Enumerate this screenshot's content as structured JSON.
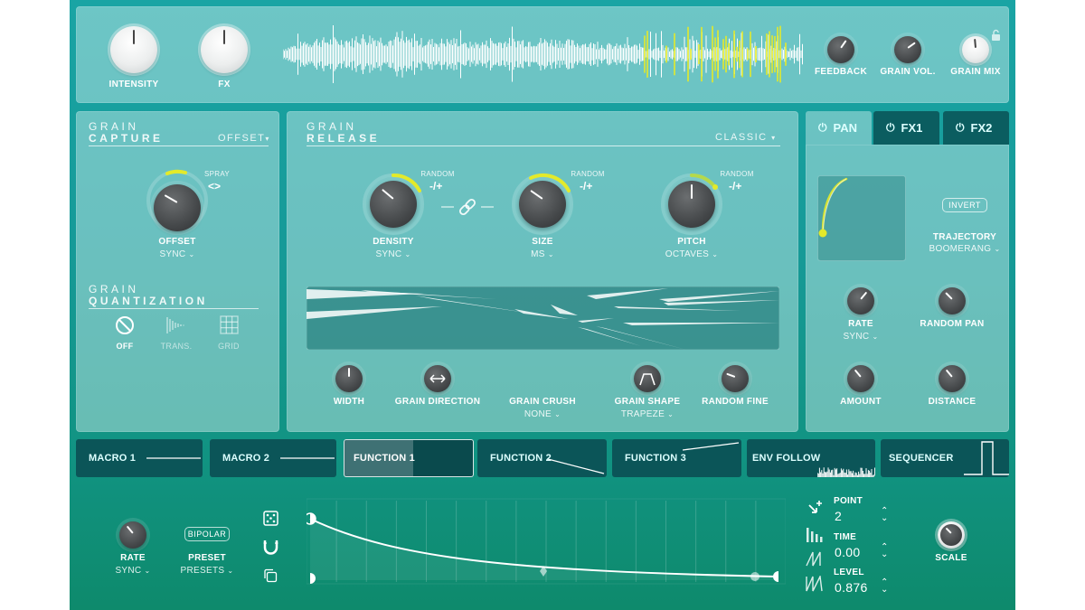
{
  "top": {
    "intensity_label": "INTENSITY",
    "fx_label": "FX",
    "feedback_label": "FEEDBACK",
    "grain_vol_label": "GRAIN VOL.",
    "grain_mix_label": "GRAIN MIX"
  },
  "grain_capture": {
    "title_line1": "GRAIN",
    "title_line2": "CAPTURE",
    "mode": "OFFSET",
    "spray_label": "SPRAY",
    "spray_arrows": "<>",
    "offset_label": "OFFSET",
    "offset_mode": "SYNC"
  },
  "grain_quantization": {
    "title_line1": "GRAIN",
    "title_line2": "QUANTIZATION",
    "options": [
      "OFF",
      "TRANS.",
      "GRID"
    ]
  },
  "grain_release": {
    "title_line1": "GRAIN",
    "title_line2": "RELEASE",
    "mode": "CLASSIC",
    "random_label": "RANDOM",
    "random_sign": "-/+",
    "density_label": "DENSITY",
    "density_mode": "SYNC",
    "size_label": "SIZE",
    "size_mode": "MS",
    "pitch_label": "PITCH",
    "pitch_mode": "OCTAVES",
    "width_label": "WIDTH",
    "grain_direction_label": "GRAIN DIRECTION",
    "grain_crush_label": "GRAIN CRUSH",
    "grain_crush_value": "NONE",
    "grain_shape_label": "GRAIN SHAPE",
    "grain_shape_value": "TRAPEZE",
    "random_fine_label": "RANDOM FINE"
  },
  "fx_tabs": [
    "PAN",
    "FX1",
    "FX2"
  ],
  "pan": {
    "invert_label": "INVERT",
    "trajectory_label": "TRAJECTORY",
    "trajectory_value": "BOOMERANG",
    "rate_label": "RATE",
    "rate_mode": "SYNC",
    "random_pan_label": "RANDOM PAN",
    "amount_label": "AMOUNT",
    "distance_label": "DISTANCE"
  },
  "mod_tabs": [
    "MACRO 1",
    "MACRO 2",
    "FUNCTION 1",
    "FUNCTION 2",
    "FUNCTION 3",
    "ENV FOLLOW",
    "SEQUENCER"
  ],
  "mod_active": "FUNCTION 1",
  "function": {
    "rate_label": "RATE",
    "rate_mode": "SYNC",
    "bipolar_label": "BIPOLAR",
    "preset_label": "PRESET",
    "preset_value": "PRESETS",
    "point_label": "POINT",
    "point_value": "2",
    "time_label": "TIME",
    "time_value": "0.00",
    "level_label": "LEVEL",
    "level_value": "0.876",
    "scale_label": "SCALE"
  },
  "colors": {
    "accent": "#e3ea2a",
    "background": "#169a98",
    "tab_dark": "#0b5558"
  }
}
